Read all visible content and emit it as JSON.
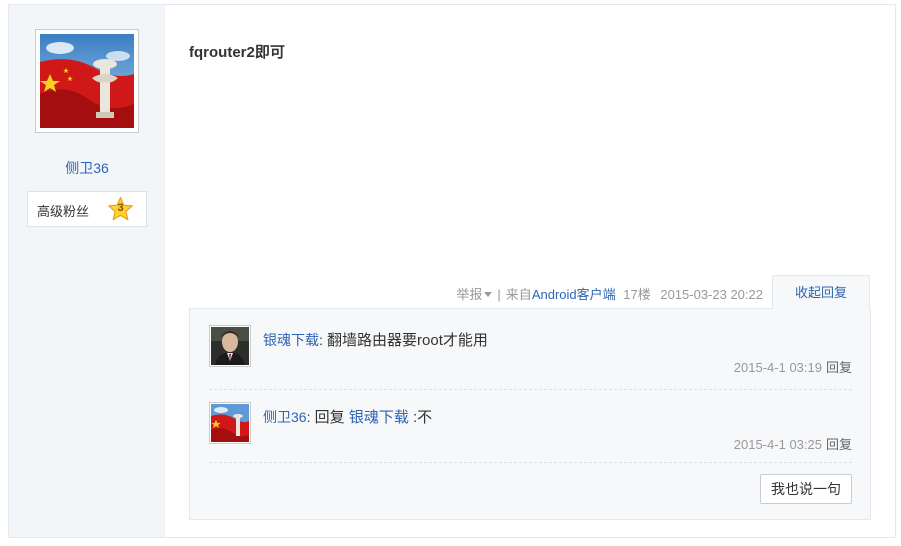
{
  "author": {
    "name": "侧卫36",
    "level_name": "高级粉丝",
    "level_num": "3"
  },
  "post": {
    "content": "fqrouter2即可",
    "report_label": "举报",
    "separator": "|",
    "from_prefix": "来自",
    "client": "Android客户端",
    "floor": "17楼",
    "time": "2015-03-23 20:22",
    "collapse_label": "收起回复"
  },
  "replies": [
    {
      "user": "银魂下载",
      "colon": ":",
      "text": " 翻墙路由器要root才能用",
      "time": "2015-4-1 03:19",
      "reply_label": "回复",
      "avatar": "man-portrait"
    },
    {
      "user": "侧卫36",
      "colon": ":",
      "reply_prefix": " 回复 ",
      "target": "银魂下载",
      "text": " :不",
      "time": "2015-4-1 03:25",
      "reply_label": "回复",
      "avatar": "flag-portrait"
    }
  ],
  "say_button": "我也说一句",
  "colors": {
    "link": "#2d64b3",
    "sidebar_bg": "#f3f6f9",
    "reply_bg": "#f7f8fa"
  }
}
